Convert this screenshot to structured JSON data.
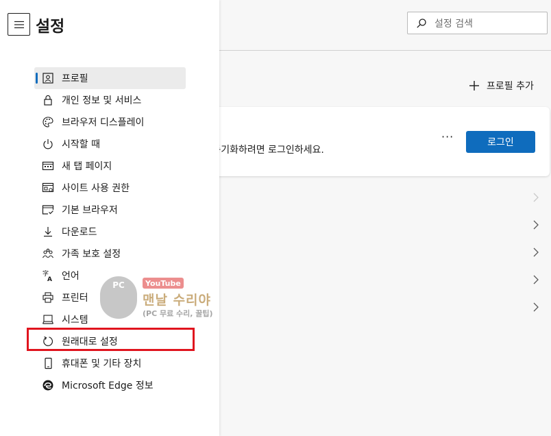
{
  "header": {
    "title": "설정",
    "search_placeholder": "설정 검색"
  },
  "profile": {
    "add_profile_label": "프로필 추가",
    "card_description": "을 동기화하려면 로그인하세요.",
    "more_label": "···",
    "login_label": "로그인"
  },
  "nav": {
    "items": [
      {
        "label": "프로필",
        "icon": "profile-icon",
        "selected": true
      },
      {
        "label": "개인 정보 및 서비스",
        "icon": "lock-icon"
      },
      {
        "label": "브라우저 디스플레이",
        "icon": "palette-icon"
      },
      {
        "label": "시작할 때",
        "icon": "power-icon"
      },
      {
        "label": "새 탭 페이지",
        "icon": "new-tab-icon"
      },
      {
        "label": "사이트 사용 권한",
        "icon": "site-permissions-icon"
      },
      {
        "label": "기본 브라우저",
        "icon": "default-browser-icon"
      },
      {
        "label": "다운로드",
        "icon": "download-icon"
      },
      {
        "label": "가족 보호 설정",
        "icon": "family-icon"
      },
      {
        "label": "언어",
        "icon": "language-icon"
      },
      {
        "label": "프린터",
        "icon": "printer-icon"
      },
      {
        "label": "시스템",
        "icon": "system-icon"
      },
      {
        "label": "원래대로 설정",
        "icon": "reset-icon",
        "highlighted": true
      },
      {
        "label": "휴대폰 및 기타 장치",
        "icon": "phone-icon"
      },
      {
        "label": "Microsoft Edge 정보",
        "icon": "edge-icon"
      }
    ]
  },
  "watermark": {
    "logo_text": "PC",
    "badge": "YouTube",
    "title": "맨날 수리야",
    "subtitle": "(PC 무료 수리, 꿀팁)"
  },
  "colors": {
    "accent": "#0f6cbd",
    "highlight": "#e0141e",
    "panel_bg": "#ffffff",
    "main_bg": "#f7f7f7"
  }
}
